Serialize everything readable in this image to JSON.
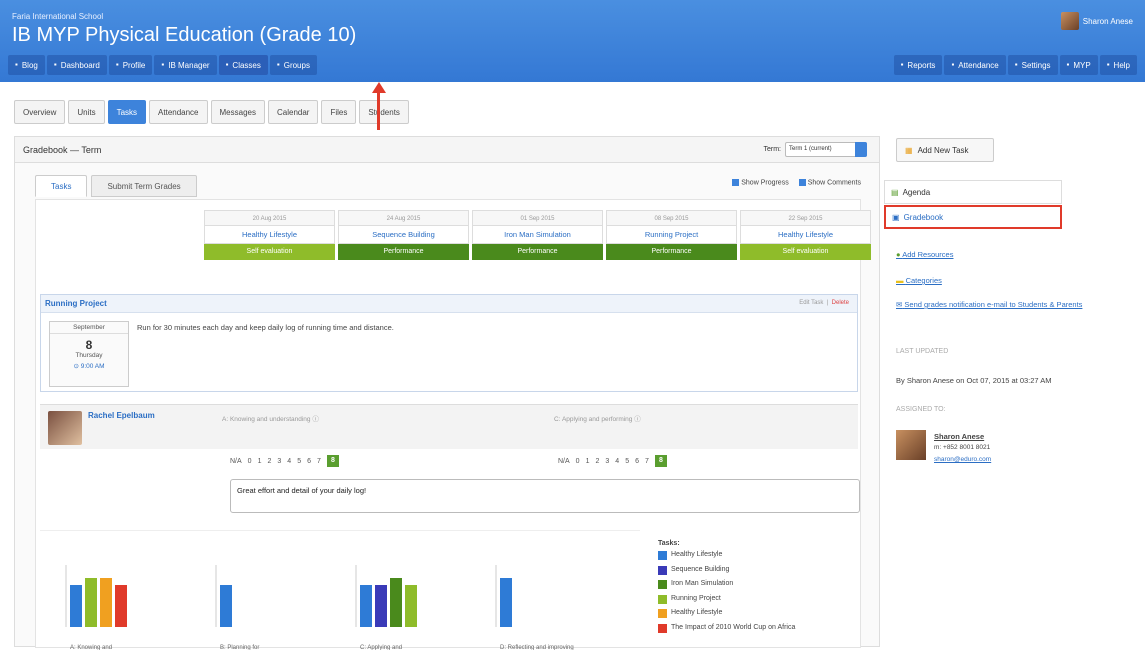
{
  "app": {
    "school": "Faria International School",
    "title": "IB MYP Physical Education (Grade 10)",
    "user": "Sharon Anese"
  },
  "nav_left": [
    {
      "label": "Blog",
      "icon": "blog-icon"
    },
    {
      "label": "Dashboard",
      "icon": "dashboard-icon"
    },
    {
      "label": "Profile",
      "icon": "profile-icon"
    },
    {
      "label": "IB Manager",
      "icon": "globe-icon"
    },
    {
      "label": "Classes",
      "icon": "classes-icon"
    },
    {
      "label": "Groups",
      "icon": "groups-icon"
    }
  ],
  "nav_right": [
    {
      "label": "Reports",
      "icon": "reports-icon"
    },
    {
      "label": "Attendance",
      "icon": "attendance-icon"
    },
    {
      "label": "Settings",
      "icon": "gear-icon"
    },
    {
      "label": "MYP",
      "icon": "search-icon"
    },
    {
      "label": "Help",
      "icon": "help-icon"
    }
  ],
  "tabs": [
    "Overview",
    "Units",
    "Tasks",
    "Attendance",
    "Messages",
    "Calendar",
    "Files",
    "Students"
  ],
  "gradebook": {
    "title": "Gradebook — Term",
    "term_label": "Term:",
    "term_value": "Term 1 (current)",
    "subtabs": [
      "Tasks",
      "Submit Term Grades"
    ],
    "show_progress": "Show Progress",
    "show_comments": "Show Comments"
  },
  "tasks": [
    {
      "date": "20 Aug 2015",
      "name": "Healthy Lifestyle",
      "type": "Self evaluation",
      "color": "#8fbc2a"
    },
    {
      "date": "24 Aug 2015",
      "name": "Sequence Building",
      "type": "Performance",
      "color": "#4a8a1c"
    },
    {
      "date": "01 Sep 2015",
      "name": "Iron Man Simulation",
      "type": "Performance",
      "color": "#4a8a1c"
    },
    {
      "date": "08 Sep 2015",
      "name": "Running Project",
      "type": "Performance",
      "color": "#4a8a1c"
    },
    {
      "date": "22 Sep 2015",
      "name": "Healthy Lifestyle",
      "type": "Self evaluation",
      "color": "#8fbc2a"
    }
  ],
  "running_project": {
    "title": "Running Project",
    "edit": "Edit Task",
    "delete": "Delete",
    "month": "September",
    "day": "8",
    "weekday": "Thursday",
    "time": "9:00 AM",
    "description": "Run for 30 minutes each day and keep daily log of running time and distance."
  },
  "student": {
    "name": "Rachel Epelbaum",
    "crit_a": "A: Knowing and understanding",
    "crit_c": "C: Applying and performing",
    "scale": [
      "N/A",
      "0",
      "1",
      "2",
      "3",
      "4",
      "5",
      "6",
      "7",
      "8"
    ],
    "selected": "8",
    "comment": "Great effort and detail of your daily log!"
  },
  "chart_data": {
    "type": "bar",
    "categories": [
      "A: Knowing and",
      "B: Planning for",
      "C: Applying and",
      "D: Reflecting and improving"
    ],
    "series": [
      {
        "name": "Healthy Lifestyle",
        "color": "#2e7bd6",
        "values": [
          6,
          6,
          6,
          7
        ]
      },
      {
        "name": "Sequence Building",
        "color": "#3a3ab8",
        "values": [
          null,
          null,
          6,
          null
        ]
      },
      {
        "name": "Iron Man Simulation",
        "color": "#4a8a1c",
        "values": [
          null,
          null,
          7,
          null
        ]
      },
      {
        "name": "Running Project",
        "color": "#8fbc2a",
        "values": [
          7,
          null,
          6,
          null
        ]
      },
      {
        "name": "Healthy Lifestyle",
        "color": "#f0a020",
        "values": [
          7,
          null,
          null,
          null
        ]
      },
      {
        "name": "The Impact of 2010 World Cup on Africa",
        "color": "#e03a2a",
        "values": [
          6,
          null,
          null,
          null
        ]
      }
    ],
    "legend_title": "Tasks:",
    "ylim": [
      0,
      8
    ]
  },
  "sidebar": {
    "add_task": "Add New Task",
    "agenda": "Agenda",
    "gradebook": "Gradebook",
    "add_resources": "Add Resources",
    "categories": "Categories",
    "send_notification": "Send grades notification e-mail to Students & Parents",
    "last_updated_label": "LAST UPDATED",
    "last_updated": "By Sharon Anese on Oct 07, 2015 at 03:27 AM",
    "assigned_label": "ASSIGNED TO:",
    "assignee": "Sharon Anese",
    "phone": "m: +852 8001 8021",
    "email": "sharon@eduro.com"
  }
}
